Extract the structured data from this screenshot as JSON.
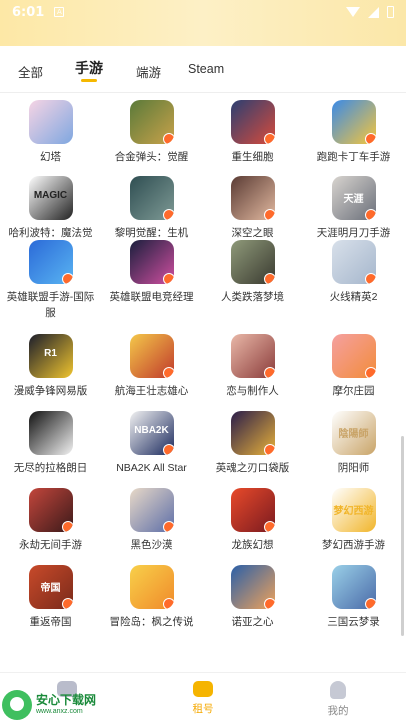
{
  "status_bar": {
    "time": "6:01",
    "sim_glyph": "A"
  },
  "tabs": [
    {
      "label": "全部",
      "active": false
    },
    {
      "label": "手游",
      "active": true
    },
    {
      "label": "端游",
      "active": false
    },
    {
      "label": "Steam",
      "active": false
    }
  ],
  "apps": [
    {
      "name": "幻塔",
      "colors": [
        "#f6d4e4",
        "#7fa7e0"
      ],
      "badge": false
    },
    {
      "name": "合金弹头：觉醒",
      "colors": [
        "#5a7a3a",
        "#c9a24a"
      ],
      "badge": true
    },
    {
      "name": "重生细胞",
      "colors": [
        "#2b3f72",
        "#d84b3b"
      ],
      "badge": true
    },
    {
      "name": "跑跑卡丁车手游",
      "colors": [
        "#3a8ae8",
        "#f6c63b"
      ],
      "badge": true
    },
    {
      "name": "哈利波特：魔法觉醒",
      "colors": [
        "#ffffff",
        "#222222"
      ],
      "badge": false,
      "logo_text": "MAGIC"
    },
    {
      "name": "黎明觉醒：生机",
      "colors": [
        "#2f4e52",
        "#7e9a95"
      ],
      "badge": true
    },
    {
      "name": "深空之眼",
      "colors": [
        "#5a3b34",
        "#e2b9a0"
      ],
      "badge": true
    },
    {
      "name": "天涯明月刀手游",
      "colors": [
        "#d8d4cf",
        "#6a6f7a"
      ],
      "badge": true,
      "logo_text": "天涯"
    },
    {
      "name": "英雄联盟手游-国际服",
      "colors": [
        "#2b6ad8",
        "#59b4f2"
      ],
      "badge": true
    },
    {
      "name": "英雄联盟电竞经理",
      "colors": [
        "#1a1f3d",
        "#d04fa0"
      ],
      "badge": true
    },
    {
      "name": "人类跌落梦境",
      "colors": [
        "#8f9a7a",
        "#3a3a30"
      ],
      "badge": true
    },
    {
      "name": "火线精英2",
      "colors": [
        "#d8e0ea",
        "#a5b6cc"
      ],
      "badge": true
    },
    {
      "name": "漫威争锋网易版",
      "colors": [
        "#1b1d2b",
        "#f0c52f"
      ],
      "badge": false,
      "logo_text": "R1"
    },
    {
      "name": "航海王壮志雄心",
      "colors": [
        "#f4c84a",
        "#c0392b"
      ],
      "badge": true
    },
    {
      "name": "恋与制作人",
      "colors": [
        "#e9b8a8",
        "#8a3b3a"
      ],
      "badge": true
    },
    {
      "name": "摩尔庄园",
      "colors": [
        "#f5a0a0",
        "#f28c3a"
      ],
      "badge": true
    },
    {
      "name": "无尽的拉格朗日",
      "colors": [
        "#111111",
        "#f2f2f2"
      ],
      "badge": false
    },
    {
      "name": "NBA2K All Star",
      "colors": [
        "#f2f2f2",
        "#1b2a5e"
      ],
      "badge": true,
      "logo_text": "NBA2K"
    },
    {
      "name": "英魂之刃口袋版",
      "colors": [
        "#2a1d4a",
        "#e8b23a"
      ],
      "badge": true
    },
    {
      "name": "阴阳师",
      "colors": [
        "#ffffff",
        "#c9a468"
      ],
      "badge": false,
      "logo_text": "陰陽師"
    },
    {
      "name": "永劫无间手游",
      "colors": [
        "#c3463c",
        "#3b1a1a"
      ],
      "badge": true
    },
    {
      "name": "黑色沙漠",
      "colors": [
        "#e8d9c8",
        "#5d6ea8"
      ],
      "badge": true
    },
    {
      "name": "龙族幻想",
      "colors": [
        "#e84a2a",
        "#7a1a20"
      ],
      "badge": true
    },
    {
      "name": "梦幻西游手游",
      "colors": [
        "#ffffff",
        "#f1b52a"
      ],
      "badge": false,
      "logo_text": "梦幻西游"
    },
    {
      "name": "重返帝国",
      "colors": [
        "#c84a2a",
        "#7a2a1a"
      ],
      "badge": true,
      "logo_text": "帝国"
    },
    {
      "name": "冒险岛：枫之传说",
      "colors": [
        "#f8d04a",
        "#f08a2a"
      ],
      "badge": true
    },
    {
      "name": "诺亚之心",
      "colors": [
        "#2a5fa8",
        "#f0a35a"
      ],
      "badge": true
    },
    {
      "name": "三国云梦录",
      "colors": [
        "#9ad0e8",
        "#4a6aa8"
      ],
      "badge": true
    }
  ],
  "bottom_nav": [
    {
      "label": "",
      "active": false
    },
    {
      "label": "租号",
      "active": true
    },
    {
      "label": "我的",
      "active": false
    }
  ],
  "watermark": {
    "title": "安心下载网",
    "url": "www.anxz.com"
  }
}
